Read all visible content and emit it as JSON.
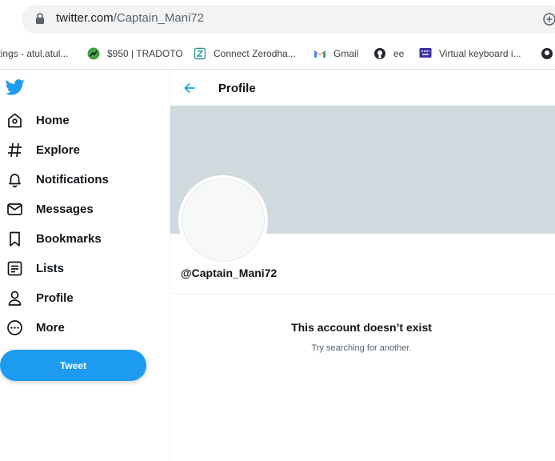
{
  "browser": {
    "url_host": "twitter.com",
    "url_path": "/Captain_Mani72"
  },
  "bookmarks": [
    {
      "label": "ttings - atul.atul...",
      "icon": "settings-partial-icon"
    },
    {
      "label": "$950 | TRADOTO",
      "icon": "tradoto-icon"
    },
    {
      "label": "Connect Zerodha...",
      "icon": "zerodha-connect-icon"
    },
    {
      "label": "Gmail",
      "icon": "gmail-icon"
    },
    {
      "label": "ee",
      "icon": "github-icon"
    },
    {
      "label": "Virtual keyboard i...",
      "icon": "virtual-keyboard-icon"
    }
  ],
  "nav": {
    "items": [
      {
        "label": "Home",
        "icon": "home-icon"
      },
      {
        "label": "Explore",
        "icon": "hashtag-icon"
      },
      {
        "label": "Notifications",
        "icon": "bell-icon"
      },
      {
        "label": "Messages",
        "icon": "envelope-icon"
      },
      {
        "label": "Bookmarks",
        "icon": "bookmark-icon"
      },
      {
        "label": "Lists",
        "icon": "list-icon"
      },
      {
        "label": "Profile",
        "icon": "person-icon"
      },
      {
        "label": "More",
        "icon": "more-circle-icon"
      }
    ],
    "tweet_label": "Tweet"
  },
  "main": {
    "header_title": "Profile",
    "handle": "@Captain_Mani72",
    "notice_title": "This account doesn’t exist",
    "notice_subtitle": "Try searching for another."
  },
  "colors": {
    "accent": "#1d9bf0",
    "banner": "#cfd9de",
    "text": "#0f1419",
    "muted": "#536471"
  }
}
